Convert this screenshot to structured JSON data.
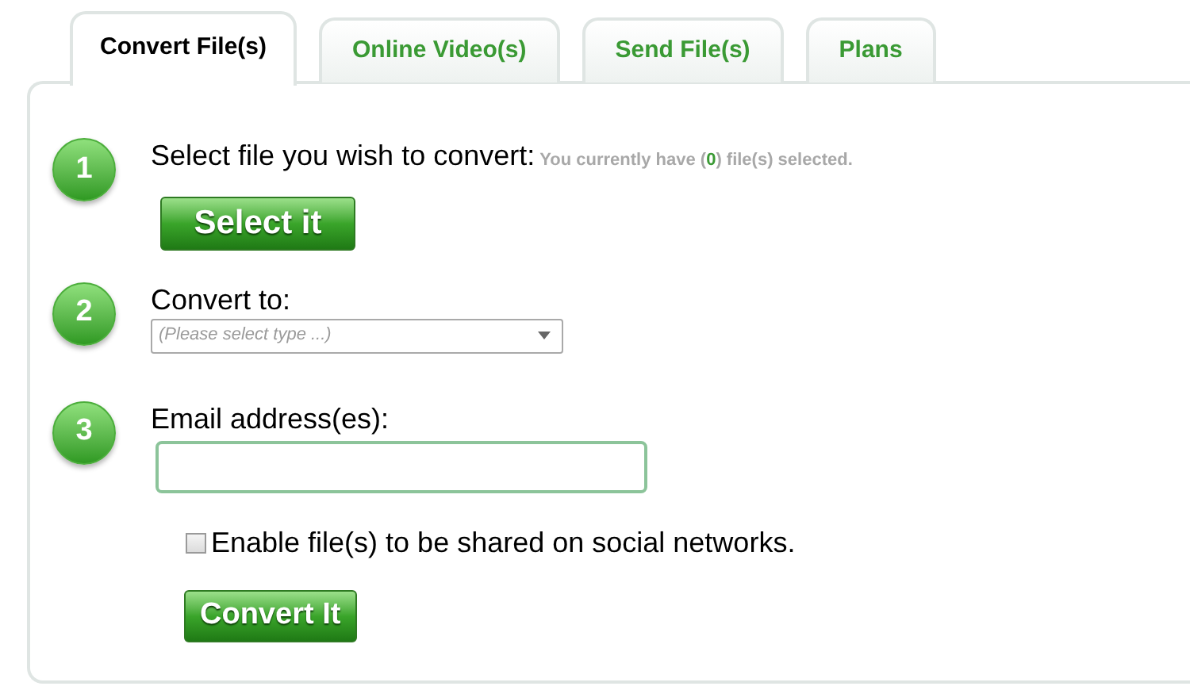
{
  "tabs": [
    {
      "label": "Convert File(s)",
      "selected": true
    },
    {
      "label": "Online Video(s)",
      "selected": false
    },
    {
      "label": "Send File(s)",
      "selected": false
    },
    {
      "label": "Plans",
      "selected": false
    }
  ],
  "steps": [
    {
      "number": "1",
      "kind": "file",
      "label": "Select file you wish to convert:",
      "note": {
        "before": "You currently have (",
        "count": "0",
        "after": ") file(s) selected."
      },
      "button": "Select it"
    },
    {
      "number": "2",
      "kind": "select",
      "label": "Convert to:",
      "placeholder": "(Please select type ...)"
    },
    {
      "number": "3",
      "kind": "email",
      "label": "Email address(es):"
    }
  ],
  "share": {
    "label": "Enable file(s) to be shared on social networks.",
    "checked": false
  },
  "submit": "Convert It"
}
